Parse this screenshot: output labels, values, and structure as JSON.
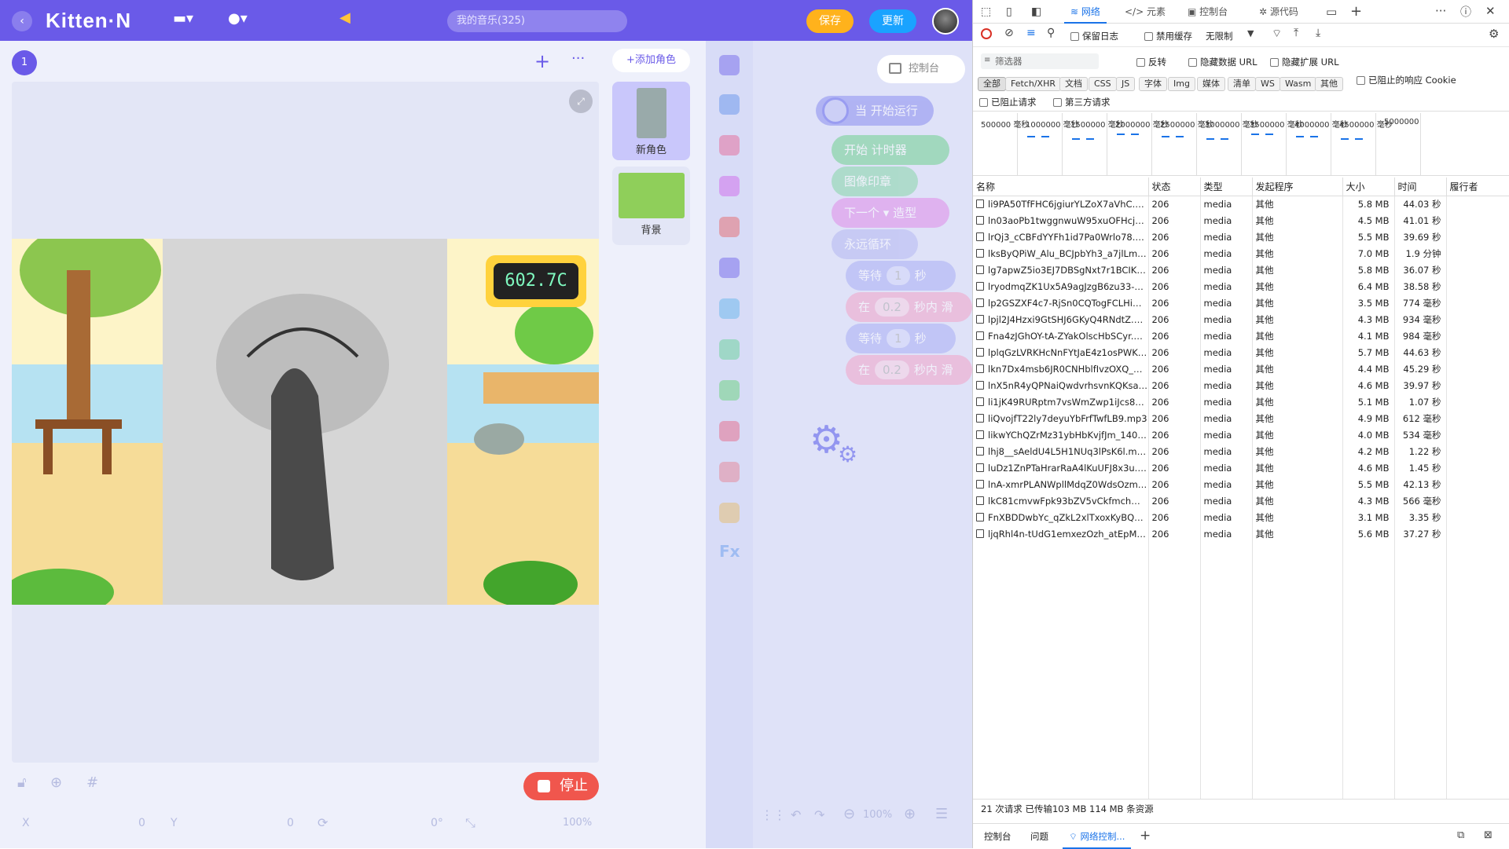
{
  "app": {
    "logo": "Kitten·N",
    "search": "我的音乐(325)",
    "save": "保存",
    "update": "更新",
    "scene_number": "1",
    "add_sprite": "+添加角色",
    "sprites": [
      {
        "label": "新角色"
      },
      {
        "label": "背景"
      }
    ],
    "console_button": "控制台",
    "timer_display": "602.7C",
    "stop": "停止",
    "coords": {
      "x_label": "X",
      "x_value": "0",
      "y_label": "Y",
      "y_value": "0",
      "rotation": "0°",
      "scale": "100%"
    },
    "zoom": "100%",
    "blocks": {
      "when_start": "当 开始运行",
      "start": "开始",
      "timer": "计时器",
      "stamp": "图像印章",
      "next": "下一个",
      "costume": "造型",
      "forever": "永远循环",
      "wait": "等待",
      "one": "1",
      "sec": "秒",
      "in": "在",
      "p02": "0.2",
      "in_sec": "秒内",
      "move": "滑"
    }
  },
  "devtools": {
    "tabs": [
      "网络",
      "元素",
      "控制台",
      "源代码"
    ],
    "toolbar": {
      "preserve_log": "保留日志",
      "disable_cache": "禁用缓存",
      "throttle": "无限制"
    },
    "filter_placeholder": "筛选器",
    "invert": "反转",
    "hide_data_urls": "隐藏数据 URL",
    "hide_ext_urls": "隐藏扩展 URL",
    "type_filters": [
      "全部",
      "Fetch/XHR",
      "文档",
      "CSS",
      "JS",
      "字体",
      "Img",
      "媒体",
      "清单",
      "WS",
      "Wasm",
      "其他"
    ],
    "blocked_cookies": "已阻止的响应 Cookie",
    "blocked_requests": "已阻止请求",
    "third_party": "第三方请求",
    "timeline_ticks": [
      "500000 毫秒",
      "1000000 毫秒",
      "1500000 毫秒",
      "2000000 毫秒",
      "2500000 毫秒",
      "3000000 毫秒",
      "3500000 毫秒",
      "4000000 毫秒",
      "4500000 毫秒",
      "5000000"
    ],
    "columns": [
      "名称",
      "状态",
      "类型",
      "发起程序",
      "大小",
      "时间",
      "履行者"
    ],
    "rows": [
      {
        "name": "li9PA50TfFHC6jgiurYLZoX7aVhC.mp3",
        "status": "206",
        "type": "media",
        "initiator": "其他",
        "size": "5.8 MB",
        "time": "44.03 秒"
      },
      {
        "name": "ln03aoPb1twggnwuW95xuOFHcjnT....",
        "status": "206",
        "type": "media",
        "initiator": "其他",
        "size": "4.5 MB",
        "time": "41.01 秒"
      },
      {
        "name": "lrQj3_cCBFdYYFh1id7Pa0Wrlo78.mp3",
        "status": "206",
        "type": "media",
        "initiator": "其他",
        "size": "5.5 MB",
        "time": "39.69 秒"
      },
      {
        "name": "lksByQPiW_Alu_BCJpbYh3_a7jlLmp3",
        "status": "206",
        "type": "media",
        "initiator": "其他",
        "size": "7.0 MB",
        "time": "1.9 分钟"
      },
      {
        "name": "lg7apwZ5io3EJ7DBSgNxt7r1BCIK.m...",
        "status": "206",
        "type": "media",
        "initiator": "其他",
        "size": "5.8 MB",
        "time": "36.07 秒"
      },
      {
        "name": "lryodmqZK1Ux5A9agJzgB6zu33-z....",
        "status": "206",
        "type": "media",
        "initiator": "其他",
        "size": "6.4 MB",
        "time": "38.58 秒"
      },
      {
        "name": "lp2GSZXF4c7-RjSn0CQTogFCLHiH....",
        "status": "206",
        "type": "media",
        "initiator": "其他",
        "size": "3.5 MB",
        "time": "774 毫秒"
      },
      {
        "name": "lpjl2J4Hzxi9GtSHJ6GKyQ4RNdtZ.mp3",
        "status": "206",
        "type": "media",
        "initiator": "其他",
        "size": "4.3 MB",
        "time": "934 毫秒"
      },
      {
        "name": "Fna4zJGhOY-tA-ZYakOlscHbSCyr.m...",
        "status": "206",
        "type": "media",
        "initiator": "其他",
        "size": "4.1 MB",
        "time": "984 毫秒"
      },
      {
        "name": "lplqGzLVRKHcNnFYtJaE4z1osPWK....",
        "status": "206",
        "type": "media",
        "initiator": "其他",
        "size": "5.7 MB",
        "time": "44.63 秒"
      },
      {
        "name": "lkn7Dx4msb6JR0CNHblfIvzOXQ_1....",
        "status": "206",
        "type": "media",
        "initiator": "其他",
        "size": "4.4 MB",
        "time": "45.29 秒"
      },
      {
        "name": "lnX5nR4yQPNaiQwdvrhsvnKQKsan....",
        "status": "206",
        "type": "media",
        "initiator": "其他",
        "size": "4.6 MB",
        "time": "39.97 秒"
      },
      {
        "name": "li1jK49RURptm7vsWmZwp1iJcs83....",
        "status": "206",
        "type": "media",
        "initiator": "其他",
        "size": "5.1 MB",
        "time": "1.07 秒"
      },
      {
        "name": "liQvojfT22ly7deyuYbFrfTwfLB9.mp3",
        "status": "206",
        "type": "media",
        "initiator": "其他",
        "size": "4.9 MB",
        "time": "612 毫秒"
      },
      {
        "name": "likwYChQZrMz31ybHbKvjfJm_140.m...",
        "status": "206",
        "type": "media",
        "initiator": "其他",
        "size": "4.0 MB",
        "time": "534 毫秒"
      },
      {
        "name": "lhj8__sAeldU4L5H1NUq3lPsK6l.mp3",
        "status": "206",
        "type": "media",
        "initiator": "其他",
        "size": "4.2 MB",
        "time": "1.22 秒"
      },
      {
        "name": "luDz1ZnPTaHrarRaA4lKuUFJ8x3u.mp3",
        "status": "206",
        "type": "media",
        "initiator": "其他",
        "size": "4.6 MB",
        "time": "1.45 秒"
      },
      {
        "name": "lnA-xmrPLANWpllMdqZ0WdsOzmy....",
        "status": "206",
        "type": "media",
        "initiator": "其他",
        "size": "5.5 MB",
        "time": "42.13 秒"
      },
      {
        "name": "lkC81cmvwFpk93bZV5vCkfmchMIZ....",
        "status": "206",
        "type": "media",
        "initiator": "其他",
        "size": "4.3 MB",
        "time": "566 毫秒"
      },
      {
        "name": "FnXBDDwbYc_qZkL2xlTxoxKyBQaY....",
        "status": "206",
        "type": "media",
        "initiator": "其他",
        "size": "3.1 MB",
        "time": "3.35 秒"
      },
      {
        "name": "ljqRhl4n-tUdG1emxezOzh_atEpM.m...",
        "status": "206",
        "type": "media",
        "initiator": "其他",
        "size": "5.6 MB",
        "time": "37.27 秒"
      }
    ],
    "summary": "21 次请求  已传输103 MB  114 MB 条资源",
    "drawer_tabs": [
      "控制台",
      "问题",
      "网络控制..."
    ],
    "colors": {
      "accent": "#1a73e8",
      "purple": "#6a5ae8"
    }
  }
}
